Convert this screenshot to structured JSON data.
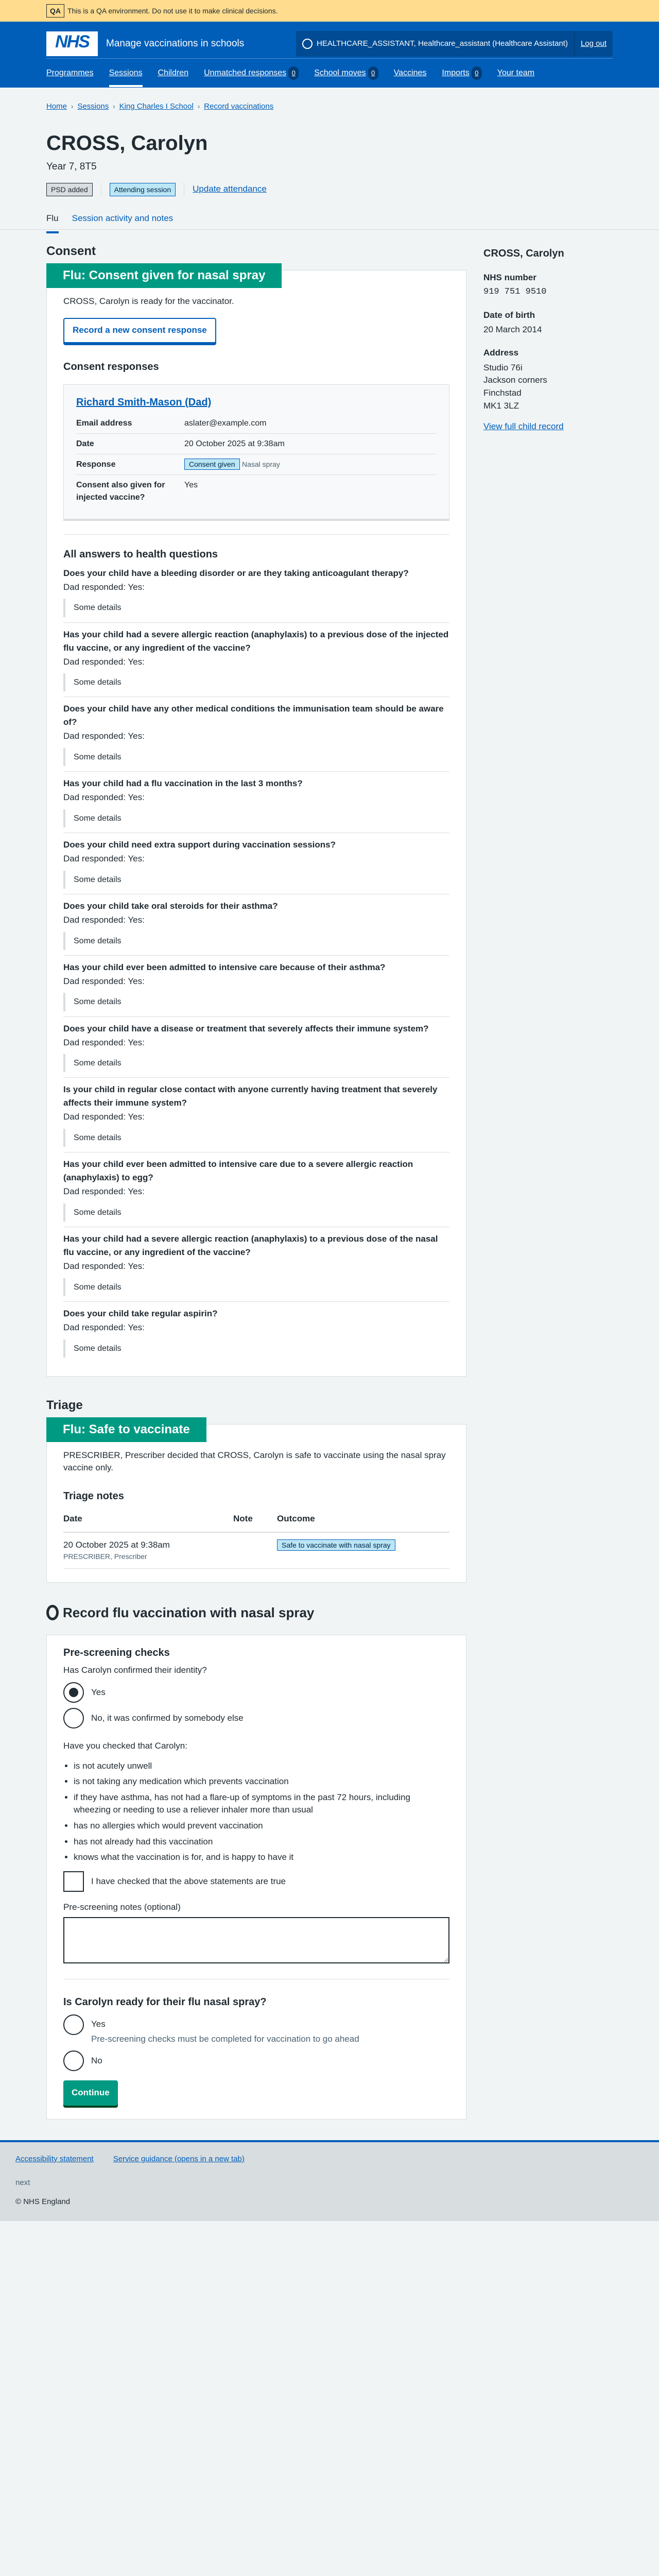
{
  "qa": {
    "tag": "QA",
    "text": "This is a QA environment. Do not use it to make clinical decisions."
  },
  "header": {
    "logo": "NHS",
    "service": "Manage vaccinations in schools",
    "account": "HEALTHCARE_ASSISTANT, Healthcare_assistant (Healthcare Assistant)",
    "logout": "Log out",
    "nav": [
      {
        "label": "Programmes"
      },
      {
        "label": "Sessions",
        "current": true
      },
      {
        "label": "Children"
      },
      {
        "label": "Unmatched responses",
        "count": "0"
      },
      {
        "label": "School moves",
        "count": "0"
      },
      {
        "label": "Vaccines"
      },
      {
        "label": "Imports",
        "count": "0"
      },
      {
        "label": "Your team"
      }
    ]
  },
  "breadcrumbs": [
    "Home",
    "Sessions",
    "King Charles I School",
    "Record vaccinations"
  ],
  "patient": {
    "name": "CROSS, Carolyn",
    "year": "Year 7, 8T5",
    "tag_psd": "PSD added",
    "tag_attending": "Attending session",
    "update_attendance": "Update attendance"
  },
  "tabs": [
    "Flu",
    "Session activity and notes"
  ],
  "consent": {
    "heading": "Consent",
    "card_title": "Flu: Consent given for nasal spray",
    "ready_text": "CROSS, Carolyn is ready for the vaccinator.",
    "new_response_button": "Record a new consent response",
    "responses_heading": "Consent responses",
    "response": {
      "parent": "Richard Smith-Mason (Dad)",
      "rows": [
        {
          "k": "Email address",
          "v": "aslater@example.com"
        },
        {
          "k": "Date",
          "v": "20 October 2025 at 9:38am"
        },
        {
          "k": "Response",
          "tag": "Consent given",
          "v": "Nasal spray"
        },
        {
          "k": "Consent also given for injected vaccine?",
          "v": "Yes"
        }
      ]
    },
    "health_heading": "All answers to health questions",
    "questions": [
      {
        "q": "Does your child have a bleeding disorder or are they taking anticoagulant therapy?",
        "r": "Dad responded: Yes:",
        "d": "Some details"
      },
      {
        "q": "Has your child had a severe allergic reaction (anaphylaxis) to a previous dose of the injected flu vaccine, or any ingredient of the vaccine?",
        "r": "Dad responded: Yes:",
        "d": "Some details"
      },
      {
        "q": "Does your child have any other medical conditions the immunisation team should be aware of?",
        "r": "Dad responded: Yes:",
        "d": "Some details"
      },
      {
        "q": "Has your child had a flu vaccination in the last 3 months?",
        "r": "Dad responded: Yes:",
        "d": "Some details"
      },
      {
        "q": "Does your child need extra support during vaccination sessions?",
        "r": "Dad responded: Yes:",
        "d": "Some details"
      },
      {
        "q": "Does your child take oral steroids for their asthma?",
        "r": "Dad responded: Yes:",
        "d": "Some details"
      },
      {
        "q": "Has your child ever been admitted to intensive care because of their asthma?",
        "r": "Dad responded: Yes:",
        "d": "Some details"
      },
      {
        "q": "Does your child have a disease or treatment that severely affects their immune system?",
        "r": "Dad responded: Yes:",
        "d": "Some details"
      },
      {
        "q": "Is your child in regular close contact with anyone currently having treatment that severely affects their immune system?",
        "r": "Dad responded: Yes:",
        "d": "Some details"
      },
      {
        "q": "Has your child ever been admitted to intensive care due to a severe allergic reaction (anaphylaxis) to egg?",
        "r": "Dad responded: Yes:",
        "d": "Some details"
      },
      {
        "q": "Has your child had a severe allergic reaction (anaphylaxis) to a previous dose of the nasal flu vaccine, or any ingredient of the vaccine?",
        "r": "Dad responded: Yes:",
        "d": "Some details"
      },
      {
        "q": "Does your child take regular aspirin?",
        "r": "Dad responded: Yes:",
        "d": "Some details"
      }
    ]
  },
  "sidebar": {
    "name": "CROSS, Carolyn",
    "nhs_label": "NHS number",
    "nhs_value": "919 751 9510",
    "dob_label": "Date of birth",
    "dob_value": "20 March 2014",
    "address_label": "Address",
    "address": [
      "Studio 76i",
      "Jackson corners",
      "Finchstad",
      "MK1 3LZ"
    ],
    "link": "View full child record"
  },
  "triage": {
    "heading": "Triage",
    "card_title": "Flu: Safe to vaccinate",
    "text": "PRESCRIBER, Prescriber decided that CROSS, Carolyn is safe to vaccinate using the nasal spray vaccine only.",
    "notes_heading": "Triage notes",
    "columns": [
      "Date",
      "Note",
      "Outcome"
    ],
    "rows": [
      {
        "date": "20 October 2025 at 9:38am",
        "by": "PRESCRIBER, Prescriber",
        "note": "",
        "outcome": "Safe to vaccinate with nasal spray"
      }
    ]
  },
  "record": {
    "heading": "Record flu vaccination with nasal spray",
    "prescreen_heading": "Pre-screening checks",
    "identity_q": "Has Carolyn confirmed their identity?",
    "identity_options": [
      "Yes",
      "No, it was confirmed by somebody else"
    ],
    "identity_selected": "Yes",
    "checked_intro": "Have you checked that Carolyn:",
    "checks": [
      "is not acutely unwell",
      "is not taking any medication which prevents vaccination",
      "if they have asthma, has not had a flare-up of symptoms in the past 72 hours, including wheezing or needing to use a reliever inhaler more than usual",
      "has no allergies which would prevent vaccination",
      "has not already had this vaccination",
      "knows what the vaccination is for, and is happy to have it"
    ],
    "confirm_label": "I have checked that the above statements are true",
    "notes_label": "Pre-screening notes (optional)",
    "notes_value": "",
    "ready_q": "Is Carolyn ready for their flu nasal spray?",
    "ready_yes": "Yes",
    "ready_hint": "Pre-screening checks must be completed for vaccination to go ahead",
    "ready_no": "No",
    "continue": "Continue"
  },
  "footer": {
    "links": [
      "Accessibility statement",
      "Service guidance (opens in a new tab)"
    ],
    "version": "next",
    "copyright": "© NHS England"
  }
}
